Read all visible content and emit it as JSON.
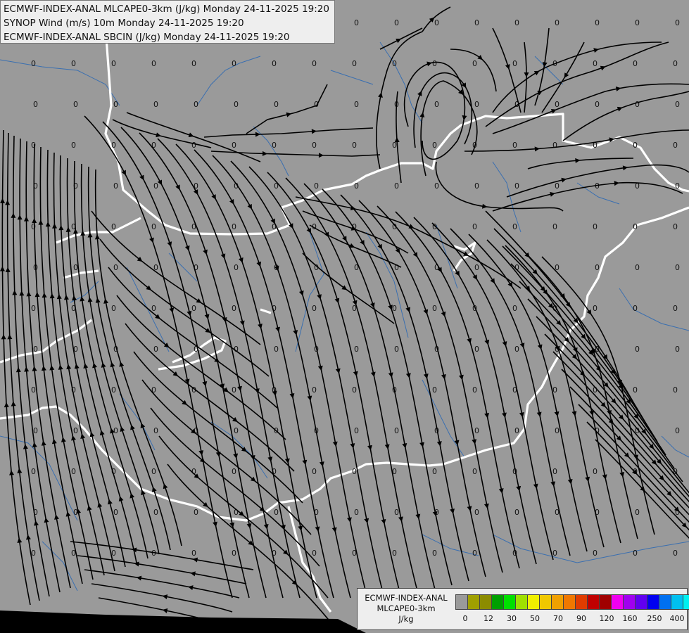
{
  "titles": [
    "ECMWF-INDEX-ANAL MLCAPE0-3km (J/kg) Monday 24-11-2025 19:20",
    "SYNOP Wind (m/s) 10m Monday 24-11-2025 19:20",
    "ECMWF-INDEX-ANAL SBCIN (J/kg) Monday 24-11-2025 19:20"
  ],
  "legend": {
    "label_lines": [
      "ECMWF-INDEX-ANAL",
      "MLCAPE0-3km",
      "J/kg"
    ],
    "colors": [
      "#9a9a9a",
      "#a0a000",
      "#8c8c00",
      "#00a000",
      "#00e000",
      "#a0e000",
      "#f0f000",
      "#f0c800",
      "#f0a000",
      "#f07800",
      "#e03c00",
      "#c00000",
      "#a00000",
      "#f000f0",
      "#a000f0",
      "#6000f0",
      "#0000f0",
      "#0070f0",
      "#00c0f0",
      "#00f0f0",
      "#a0f0f0",
      "#ffffff"
    ],
    "tick_labels": [
      "0",
      "12",
      "30",
      "50",
      "70",
      "90",
      "120",
      "160",
      "250",
      "400"
    ]
  },
  "map": {
    "background_color": "#9a9a9a",
    "border_color": "#ffffff",
    "river_color": "#3a6fb0",
    "streamline_color": "#000000",
    "grid_value_label": "0"
  }
}
